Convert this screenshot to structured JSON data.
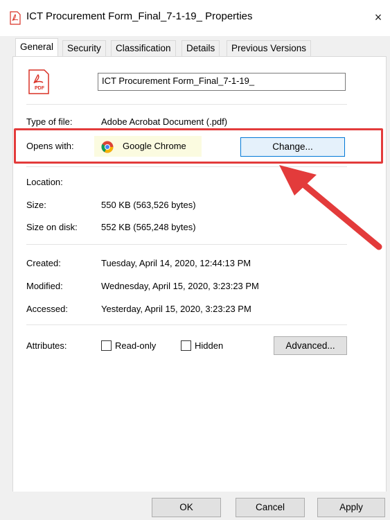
{
  "window": {
    "title": "ICT Procurement Form_Final_7-1-19_ Properties",
    "close_glyph": "×"
  },
  "tabs": [
    {
      "label": "General"
    },
    {
      "label": "Security"
    },
    {
      "label": "Classification"
    },
    {
      "label": "Details"
    },
    {
      "label": "Previous Versions"
    }
  ],
  "general": {
    "file_name": "ICT Procurement Form_Final_7-1-19_",
    "file_icon_text": "PDF",
    "type_label": "Type of file:",
    "type_value": "Adobe Acrobat Document (.pdf)",
    "opens_label": "Opens with:",
    "opens_value": "Google Chrome",
    "change_label": "Change...",
    "location_label": "Location:",
    "location_value": "",
    "size_label": "Size:",
    "size_value": "550 KB (563,526 bytes)",
    "size_disk_label": "Size on disk:",
    "size_disk_value": "552 KB (565,248 bytes)",
    "created_label": "Created:",
    "created_value": "Tuesday, April 14, 2020, 12:44:13 PM",
    "modified_label": "Modified:",
    "modified_value": "Wednesday, April 15, 2020, 3:23:23 PM",
    "accessed_label": "Accessed:",
    "accessed_value": "Yesterday, April 15, 2020, 3:23:23 PM",
    "attributes_label": "Attributes:",
    "readonly_label": "Read-only",
    "hidden_label": "Hidden",
    "advanced_label": "Advanced..."
  },
  "footer": {
    "ok_label": "OK",
    "cancel_label": "Cancel",
    "apply_label": "Apply"
  },
  "colors": {
    "highlight": "#e33b3b",
    "accent": "#0078d7",
    "pdf_red": "#d93025"
  }
}
